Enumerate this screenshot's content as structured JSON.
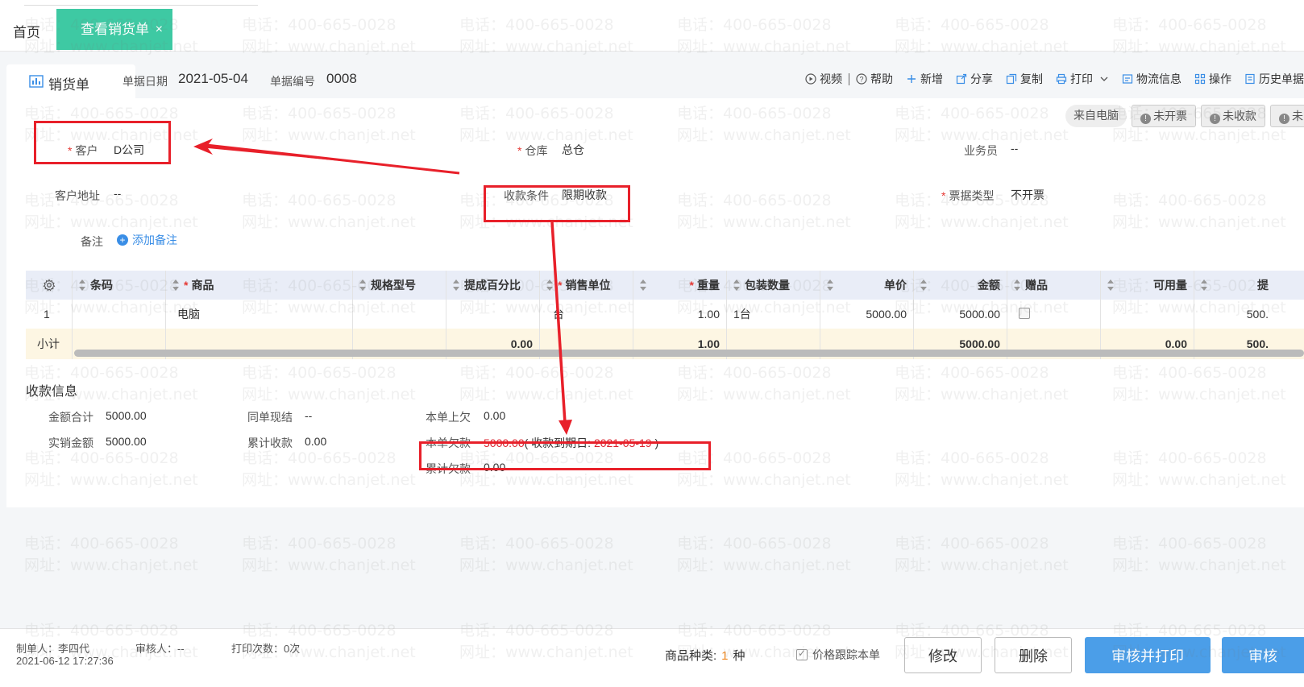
{
  "tabs": {
    "home": "首页",
    "active": "查看销货单",
    "close": "×"
  },
  "doc": {
    "tab_label": "销货单",
    "date_label": "单据日期",
    "date_value": "2021-05-04",
    "number_label": "单据编号",
    "number_value": "0008"
  },
  "toolbar": {
    "video": "视频",
    "help": "帮助",
    "add": "新增",
    "share": "分享",
    "copy": "复制",
    "print": "打印",
    "logistics": "物流信息",
    "operate": "操作",
    "history": "历史单据"
  },
  "badges": {
    "source": "来自电脑",
    "invoice": "未开票",
    "receipt": "未收款",
    "more": "未"
  },
  "fields": {
    "customer_label": "客户",
    "customer_value": "D公司",
    "warehouse_label": "仓库",
    "warehouse_value": "总仓",
    "salesman_label": "业务员",
    "salesman_value": "--",
    "address_label": "客户地址",
    "address_value": "--",
    "terms_label": "收款条件",
    "terms_value": "限期收款",
    "bill_type_label": "票据类型",
    "bill_type_value": "不开票",
    "note_label": "备注",
    "add_note": "添加备注"
  },
  "table": {
    "headers": [
      "条码",
      "商品",
      "规格型号",
      "提成百分比",
      "销售单位",
      "重量",
      "包装数量",
      "单价",
      "金额",
      "赠品",
      "可用量",
      "提"
    ],
    "row": {
      "index": "1",
      "product": "电脑",
      "unit": "台",
      "weight": "1.00",
      "pack": "1台",
      "price": "5000.00",
      "amount": "5000.00",
      "last": "500."
    },
    "subtotal": {
      "label": "小计",
      "commission": "0.00",
      "weight": "1.00",
      "amount": "5000.00",
      "available": "0.00",
      "last": "500."
    }
  },
  "payment": {
    "title": "收款信息",
    "total_label": "金额合计",
    "total_value": "5000.00",
    "actual_label": "实销金额",
    "actual_value": "5000.00",
    "same_label": "同单现结",
    "same_value": "--",
    "accum_label": "累计收款",
    "accum_value": "0.00",
    "prev_owe_label": "本单上欠",
    "prev_owe_value": "0.00",
    "owe_label": "本单欠款",
    "owe_value": "5000.00",
    "due_prefix": "( 收款到期日: ",
    "due_date": "2021-05-19",
    "due_suffix": " )",
    "accum_owe_label": "累计欠款",
    "accum_owe_value": "0.00"
  },
  "footer": {
    "maker": "制单人：李四代",
    "auditor": "审核人：--",
    "print_count": "打印次数：0次",
    "timestamp": "2021-06-12 17:27:36",
    "kinds_label": "商品种类:",
    "kinds_value": "1",
    "kinds_unit": "种",
    "track_price": "价格跟踪本单",
    "edit": "修改",
    "delete": "删除",
    "audit_print": "审核并打印",
    "audit": "审核"
  },
  "watermark": {
    "phone": "电话：400-665-0028",
    "site": "网址：www.chanjet.net"
  },
  "colors": {
    "tab_active": "#3ec9a3",
    "primary": "#4b9ee8",
    "annotation": "#e8202a",
    "required": "#e53935"
  }
}
